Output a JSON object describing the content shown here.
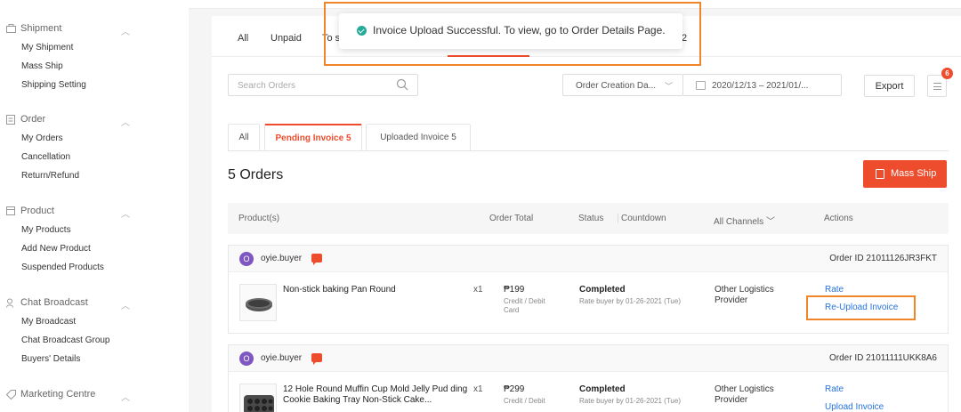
{
  "sidebar": {
    "sections": [
      {
        "title": "Shipment",
        "icon": "shipment-icon",
        "items": [
          "My Shipment",
          "Mass Ship",
          "Shipping Setting"
        ]
      },
      {
        "title": "Order",
        "icon": "order-icon",
        "items": [
          "My Orders",
          "Cancellation",
          "Return/Refund"
        ]
      },
      {
        "title": "Product",
        "icon": "product-icon",
        "items": [
          "My Products",
          "Add New Product",
          "Suspended Products"
        ]
      },
      {
        "title": "Chat Broadcast",
        "icon": "broadcast-icon",
        "items": [
          "My Broadcast",
          "Chat Broadcast Group",
          "Buyers' Details"
        ]
      },
      {
        "title": "Marketing Centre",
        "icon": "marketing-icon",
        "items": []
      }
    ]
  },
  "top_tabs": {
    "all": "All",
    "unpaid": "Unpaid",
    "to_ship_partial": "To s",
    "count_partial": "2"
  },
  "toast": {
    "message": "Invoice Upload Successful. To view, go to Order Details Page."
  },
  "filters": {
    "search_placeholder": "Search Orders",
    "sort_label": "Order Creation Da...",
    "date_range": "2020/12/13 – 2021/01/...",
    "export_label": "Export",
    "notification_count": "6"
  },
  "sub_tabs": [
    {
      "label": "All",
      "active": false
    },
    {
      "label": "Pending Invoice 5",
      "active": true
    },
    {
      "label": "Uploaded Invoice 5",
      "active": false
    }
  ],
  "orders_count": "5 Orders",
  "mass_ship_label": "Mass Ship",
  "table_headers": {
    "products": "Product(s)",
    "order_total": "Order Total",
    "status": "Status",
    "countdown": "Countdown",
    "channels": "All Channels",
    "actions": "Actions"
  },
  "orders": [
    {
      "avatar_letter": "O",
      "buyer": "oyie.buyer",
      "order_id": "Order ID 21011126JR3FKT",
      "product_name": "Non-stick baking Pan Round",
      "qty": "x1",
      "price": "₱199",
      "payment": "Credit / Debit Card",
      "status": "Completed",
      "status_note": "Rate buyer by 01-26-2021 (Tue)",
      "carrier": "Other Logistics Provider",
      "action_rate": "Rate",
      "action_reupload": "Re-Upload Invoice"
    },
    {
      "avatar_letter": "O",
      "buyer": "oyie.buyer",
      "order_id": "Order ID 21011111UKK8A6",
      "product_name": "12 Hole Round Muffin Cup Mold Jelly Pud ding Cookie Baking Tray Non-Stick Cake...",
      "qty": "x1",
      "price": "₱299",
      "payment": "Credit / Debit",
      "status": "Completed",
      "status_note": "Rate buyer by 01-26-2021 (Tue)",
      "carrier": "Other Logistics Provider",
      "action_rate": "Rate",
      "action_reupload": "Upload Invoice"
    }
  ],
  "colors": {
    "accent": "#ee4d2d",
    "link": "#2673dd",
    "highlight": "#f0852a",
    "success": "#26aa99"
  }
}
